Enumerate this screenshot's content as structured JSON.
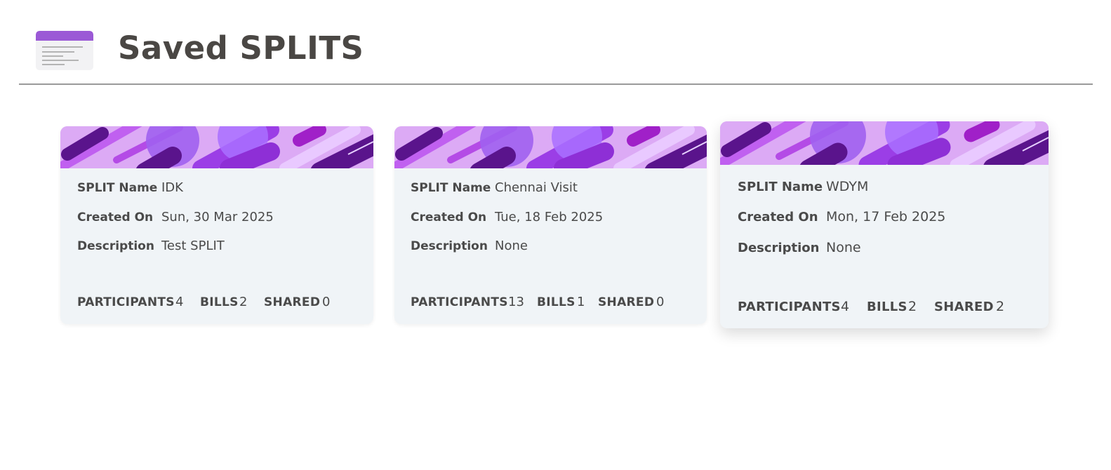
{
  "header": {
    "title": "Saved SPLITS",
    "icon": "saved-splits-icon"
  },
  "labels": {
    "split_name": "SPLIT Name",
    "created_on": "Created On",
    "description": "Description",
    "participants": "PARTICIPANTS",
    "bills": "BILLS",
    "shared": "SHARED"
  },
  "colors": {
    "accent": "#9b59d6",
    "card_background": "#f0f4f7",
    "title_text": "#4a4744"
  },
  "splits": [
    {
      "name": "IDK",
      "created_on": "Sun, 30 Mar 2025",
      "description": "Test SPLIT",
      "participants": "4",
      "bills": "2",
      "shared": "0"
    },
    {
      "name": "Chennai Visit",
      "created_on": "Tue, 18 Feb 2025",
      "description": "None",
      "participants": "13",
      "bills": "1",
      "shared": "0"
    },
    {
      "name": "WDYM",
      "created_on": "Mon, 17 Feb 2025",
      "description": "None",
      "participants": "4",
      "bills": "2",
      "shared": "2"
    }
  ]
}
